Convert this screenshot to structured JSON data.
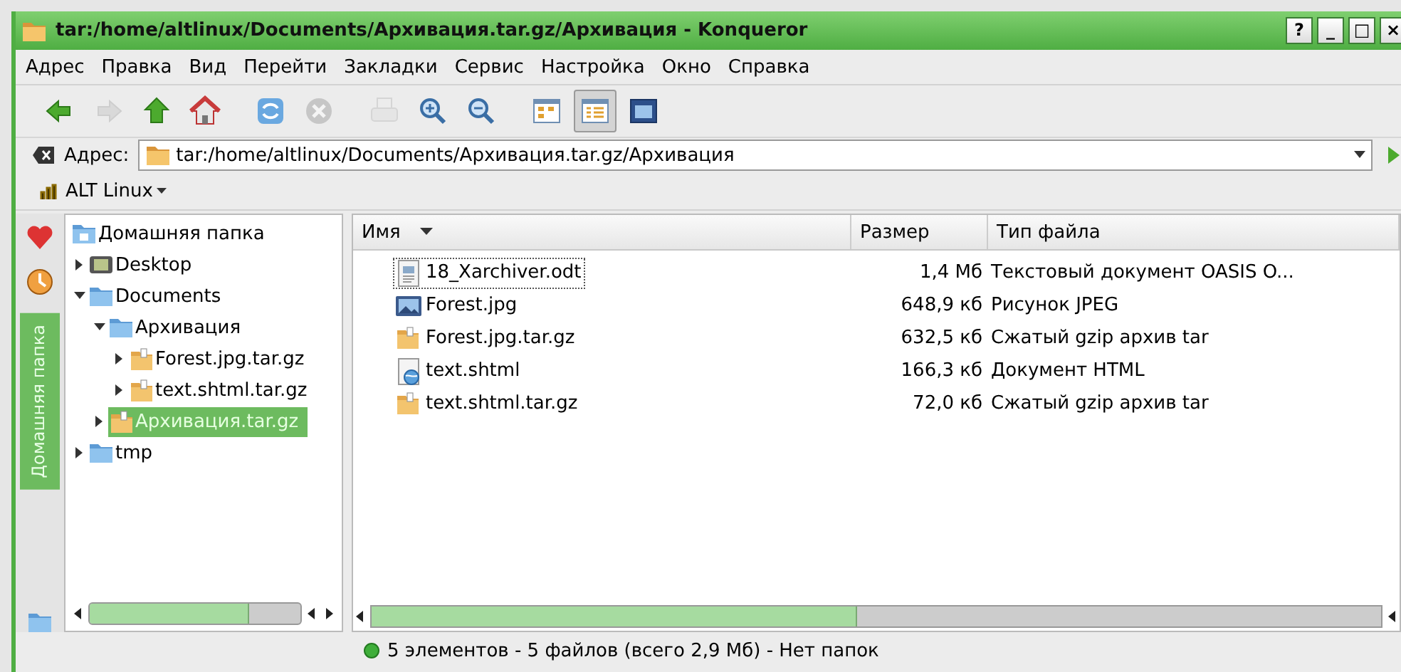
{
  "window": {
    "title": "tar:/home/altlinux/Documents/Архивация.tar.gz/Архивация - Konqueror",
    "buttons": [
      "?",
      "_",
      "□",
      "×"
    ]
  },
  "menu": [
    "Адрес",
    "Правка",
    "Вид",
    "Перейти",
    "Закладки",
    "Сервис",
    "Настройка",
    "Окно",
    "Справка"
  ],
  "toolbar": [
    {
      "kind": "back",
      "disabled": false
    },
    {
      "kind": "forward",
      "disabled": true
    },
    {
      "kind": "up",
      "disabled": false
    },
    {
      "kind": "home",
      "disabled": false
    },
    {
      "kind": "reload",
      "disabled": false
    },
    {
      "kind": "stop",
      "disabled": true
    },
    {
      "kind": "print",
      "disabled": true
    },
    {
      "kind": "zoom-in",
      "disabled": false
    },
    {
      "kind": "zoom-out",
      "disabled": false
    },
    {
      "kind": "view-icons",
      "selected": false
    },
    {
      "kind": "view-details",
      "selected": true
    },
    {
      "kind": "view-preview",
      "selected": false
    }
  ],
  "address": {
    "label": "Адрес:",
    "value": "tar:/home/altlinux/Documents/Архивация.tar.gz/Архивация"
  },
  "bookmarks": [
    "ALT Linux"
  ],
  "sidebar": {
    "tab_label": "Домашняя папка",
    "tree": [
      {
        "label": "Домашняя папка",
        "kind": "home",
        "selected": false,
        "children": [
          {
            "label": "Desktop",
            "kind": "desktop",
            "expanded": false,
            "selected": false
          },
          {
            "label": "Documents",
            "kind": "folder",
            "expanded": true,
            "selected": false,
            "children": [
              {
                "label": "Архивация",
                "kind": "folder",
                "expanded": true,
                "selected": false,
                "children": [
                  {
                    "label": "Forest.jpg.tar.gz",
                    "kind": "archive",
                    "expanded": false,
                    "selected": false
                  },
                  {
                    "label": "text.shtml.tar.gz",
                    "kind": "archive",
                    "expanded": false,
                    "selected": false
                  }
                ]
              },
              {
                "label": "Архивация.tar.gz",
                "kind": "archive",
                "expanded": false,
                "selected": true
              }
            ]
          },
          {
            "label": "tmp",
            "kind": "folder",
            "expanded": false,
            "selected": false
          }
        ]
      }
    ]
  },
  "table": {
    "columns": [
      "Имя",
      "Размер",
      "Тип файла"
    ],
    "rows": [
      {
        "name": "18_Xarchiver.odt",
        "kind": "document",
        "size": "1,4 Мб",
        "type": "Текстовый документ OASIS O...",
        "focused": true
      },
      {
        "name": "Forest.jpg",
        "kind": "image",
        "size": "648,9 кб",
        "type": "Рисунок JPEG",
        "focused": false
      },
      {
        "name": "Forest.jpg.tar.gz",
        "kind": "archive",
        "size": "632,5 кб",
        "type": "Сжатый gzip архив tar",
        "focused": false
      },
      {
        "name": "text.shtml",
        "kind": "html",
        "size": "166,3 кб",
        "type": "Документ HTML",
        "focused": false
      },
      {
        "name": "text.shtml.tar.gz",
        "kind": "archive",
        "size": "72,0 кб",
        "type": "Сжатый gzip архив tar",
        "focused": false
      }
    ]
  },
  "status_bar": "5 элементов - 5 файлов (всего 2,9 Мб) - Нет папок"
}
